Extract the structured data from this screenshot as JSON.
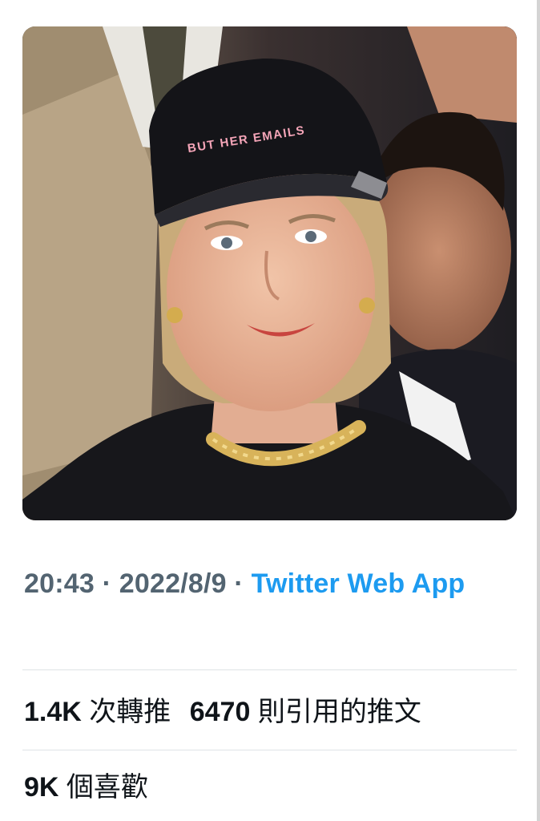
{
  "tweet": {
    "media": {
      "cap_text": "BUT HER EMAILS"
    },
    "meta": {
      "time": "20:43",
      "separator": " · ",
      "date": "2022/8/9",
      "source": "Twitter Web App"
    },
    "stats": {
      "retweets": {
        "count": "1.4K",
        "label": "次轉推"
      },
      "quotes": {
        "count": "6470",
        "label": "則引用的推文"
      },
      "likes": {
        "count": "9K",
        "label": "個喜歡"
      }
    }
  },
  "colors": {
    "secondary_text": "#536471",
    "link": "#1d9bf0",
    "primary_text": "#0f1419",
    "divider": "#dfe3e6"
  }
}
